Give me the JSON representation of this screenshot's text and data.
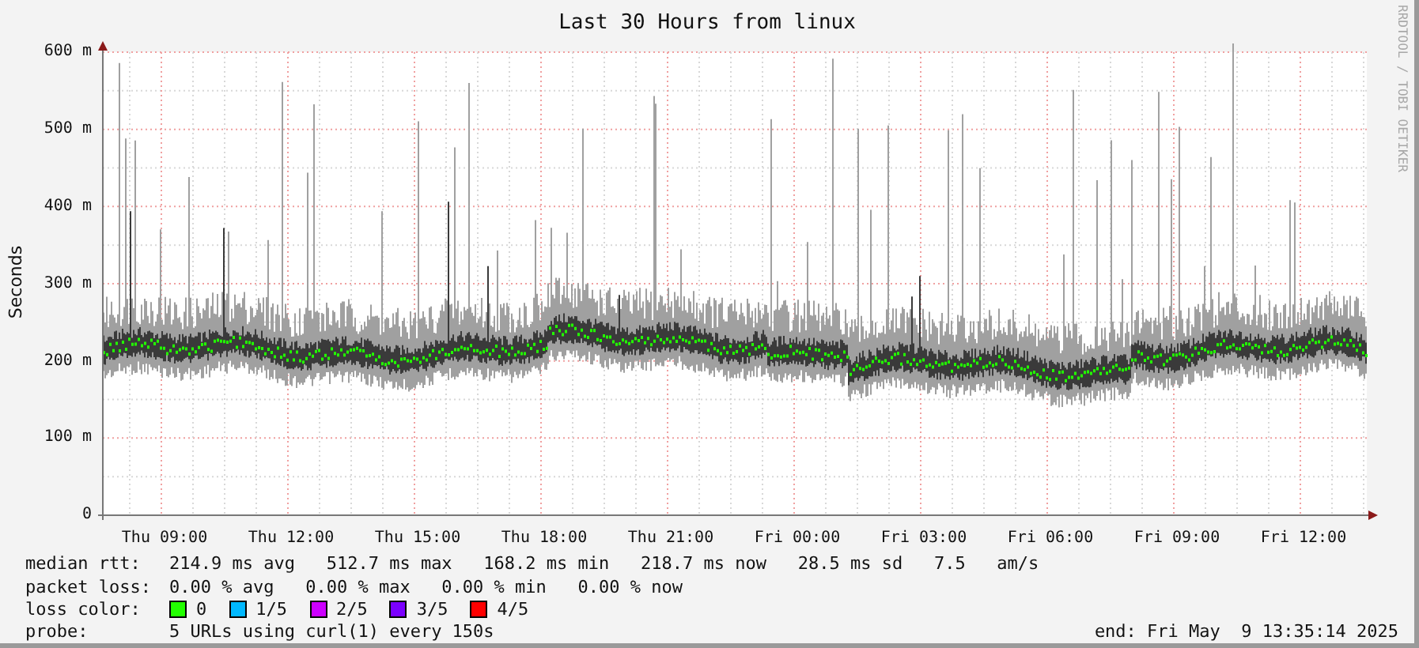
{
  "graph": {
    "title": "Last 30 Hours from linux",
    "y_axis_title": "Seconds",
    "credit": "RRDTOOL / TOBI OETIKER",
    "y_ticks": [
      "600 m",
      "500 m",
      "400 m",
      "300 m",
      "200 m",
      "100 m",
      "0"
    ],
    "x_ticks": [
      "Thu 09:00",
      "Thu 12:00",
      "Thu 15:00",
      "Thu 18:00",
      "Thu 21:00",
      "Fri 00:00",
      "Fri 03:00",
      "Fri 06:00",
      "Fri 09:00",
      "Fri 12:00"
    ]
  },
  "legend": {
    "rows": [
      {
        "label": "median rtt:",
        "text": "214.9 ms avg   512.7 ms max   168.2 ms min   218.7 ms now   28.5 ms sd   7.5   am/s"
      },
      {
        "label": "packet loss:",
        "text": "0.00 % avg   0.00 % max   0.00 % min   0.00 % now"
      }
    ],
    "loss_color": {
      "label": "loss color:",
      "items": [
        {
          "label": "0",
          "color": "#22ff00"
        },
        {
          "label": "1/5",
          "color": "#00b8ff"
        },
        {
          "label": "2/5",
          "color": "#cc00ff"
        },
        {
          "label": "3/5",
          "color": "#7b00ff"
        },
        {
          "label": "4/5",
          "color": "#ff0000"
        }
      ]
    },
    "probe": {
      "label": "probe:",
      "text": "5 URLs using curl(1) every 150s"
    },
    "end": "end: Fri May  9 13:35:14 2025"
  }
}
